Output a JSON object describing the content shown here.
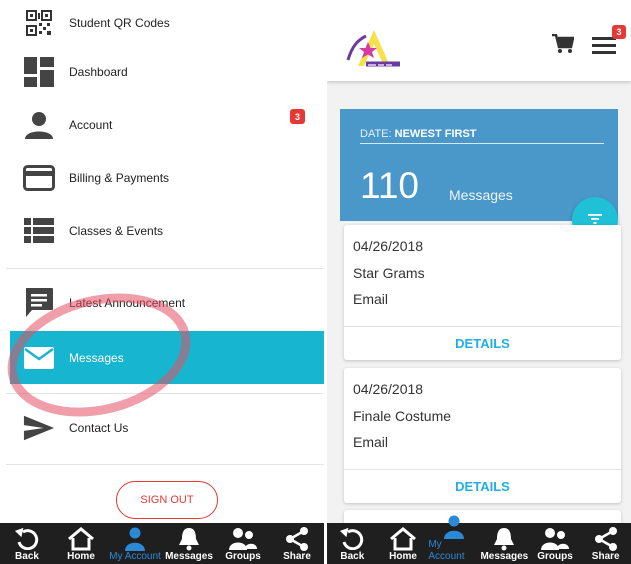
{
  "left": {
    "menu": [
      {
        "label": "Student QR Codes",
        "icon": "qr-code-icon"
      },
      {
        "label": "Dashboard",
        "icon": "dashboard-icon"
      },
      {
        "label": "Account",
        "icon": "person-icon",
        "badge": "3"
      },
      {
        "label": "Billing & Payments",
        "icon": "credit-card-icon"
      },
      {
        "label": "Classes & Events",
        "icon": "list-icon"
      },
      {
        "label": "Latest Announcement",
        "icon": "chat-icon"
      },
      {
        "label": "Messages",
        "icon": "mail-icon"
      },
      {
        "label": "Contact Us",
        "icon": "send-icon"
      }
    ],
    "sign_out_label": "SIGN OUT"
  },
  "tabbar": [
    {
      "label": "Back",
      "icon": "back-icon"
    },
    {
      "label": "Home",
      "icon": "home-icon"
    },
    {
      "label": "My Account",
      "icon": "account-icon"
    },
    {
      "label": "Messages",
      "icon": "bell-icon"
    },
    {
      "label": "Groups",
      "icon": "groups-icon"
    },
    {
      "label": "Share",
      "icon": "share-icon"
    }
  ],
  "right": {
    "cart_badge": "3",
    "sort_prefix": "DATE:",
    "sort_value": "NEWEST FIRST",
    "message_count": "110",
    "count_label": "Messages",
    "messages": [
      {
        "date": "04/26/2018",
        "title": "Star Grams",
        "type": "Email",
        "action": "DETAILS"
      },
      {
        "date": "04/26/2018",
        "title": "Finale Costume",
        "type": "Email",
        "action": "DETAILS"
      }
    ]
  },
  "colors": {
    "accent": "#17b5cf",
    "hero": "#4a97c9",
    "badge": "#e53935",
    "tabbar": "#1f1f1f",
    "tab_active": "#2a8ad8"
  }
}
